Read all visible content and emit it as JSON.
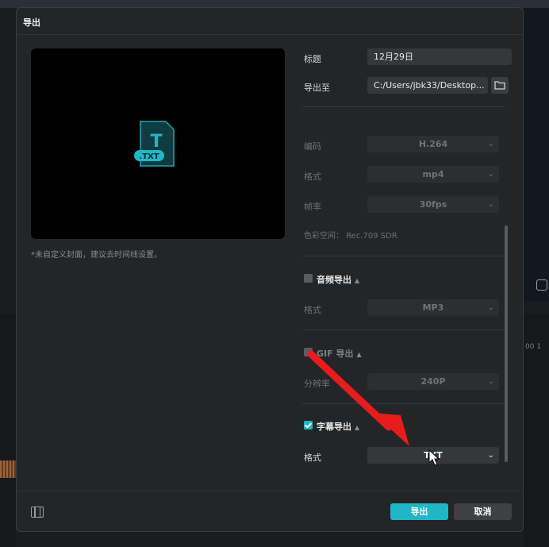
{
  "dialog": {
    "title": "导出",
    "preview_hint": "*未自定义封面，建议去时间线设置。",
    "preview_badge": ".TXT",
    "preview_letter": "T"
  },
  "fields": {
    "title_label": "标题",
    "title_value": "12月29日",
    "export_to_label": "导出至",
    "export_to_value": "C:/Users/jbk33/Desktop..."
  },
  "video": {
    "codec_label": "编码",
    "codec_value": "H.264",
    "format_label": "格式",
    "format_value": "mp4",
    "framerate_label": "帧率",
    "framerate_value": "30fps",
    "colorspace_label": "色彩空间：",
    "colorspace_value": "Rec.709 SDR"
  },
  "audio": {
    "header": "音频导出",
    "checked": false,
    "format_label": "格式",
    "format_value": "MP3"
  },
  "gif": {
    "header": "GIF 导出",
    "checked": false,
    "resolution_label": "分辨率",
    "resolution_value": "240P"
  },
  "subtitle": {
    "header": "字幕导出",
    "checked": true,
    "format_label": "格式",
    "format_value": "TXT"
  },
  "footer": {
    "export_label": "导出",
    "cancel_label": "取消"
  },
  "background": {
    "timeline_label": "00 1"
  },
  "colors": {
    "accent": "#1fb7c8",
    "annotation_arrow": "#e81c1c"
  },
  "icons": [
    "folder-icon",
    "chevron-down-icon",
    "film-icon",
    "txt-file-icon",
    "caret-up-icon"
  ]
}
